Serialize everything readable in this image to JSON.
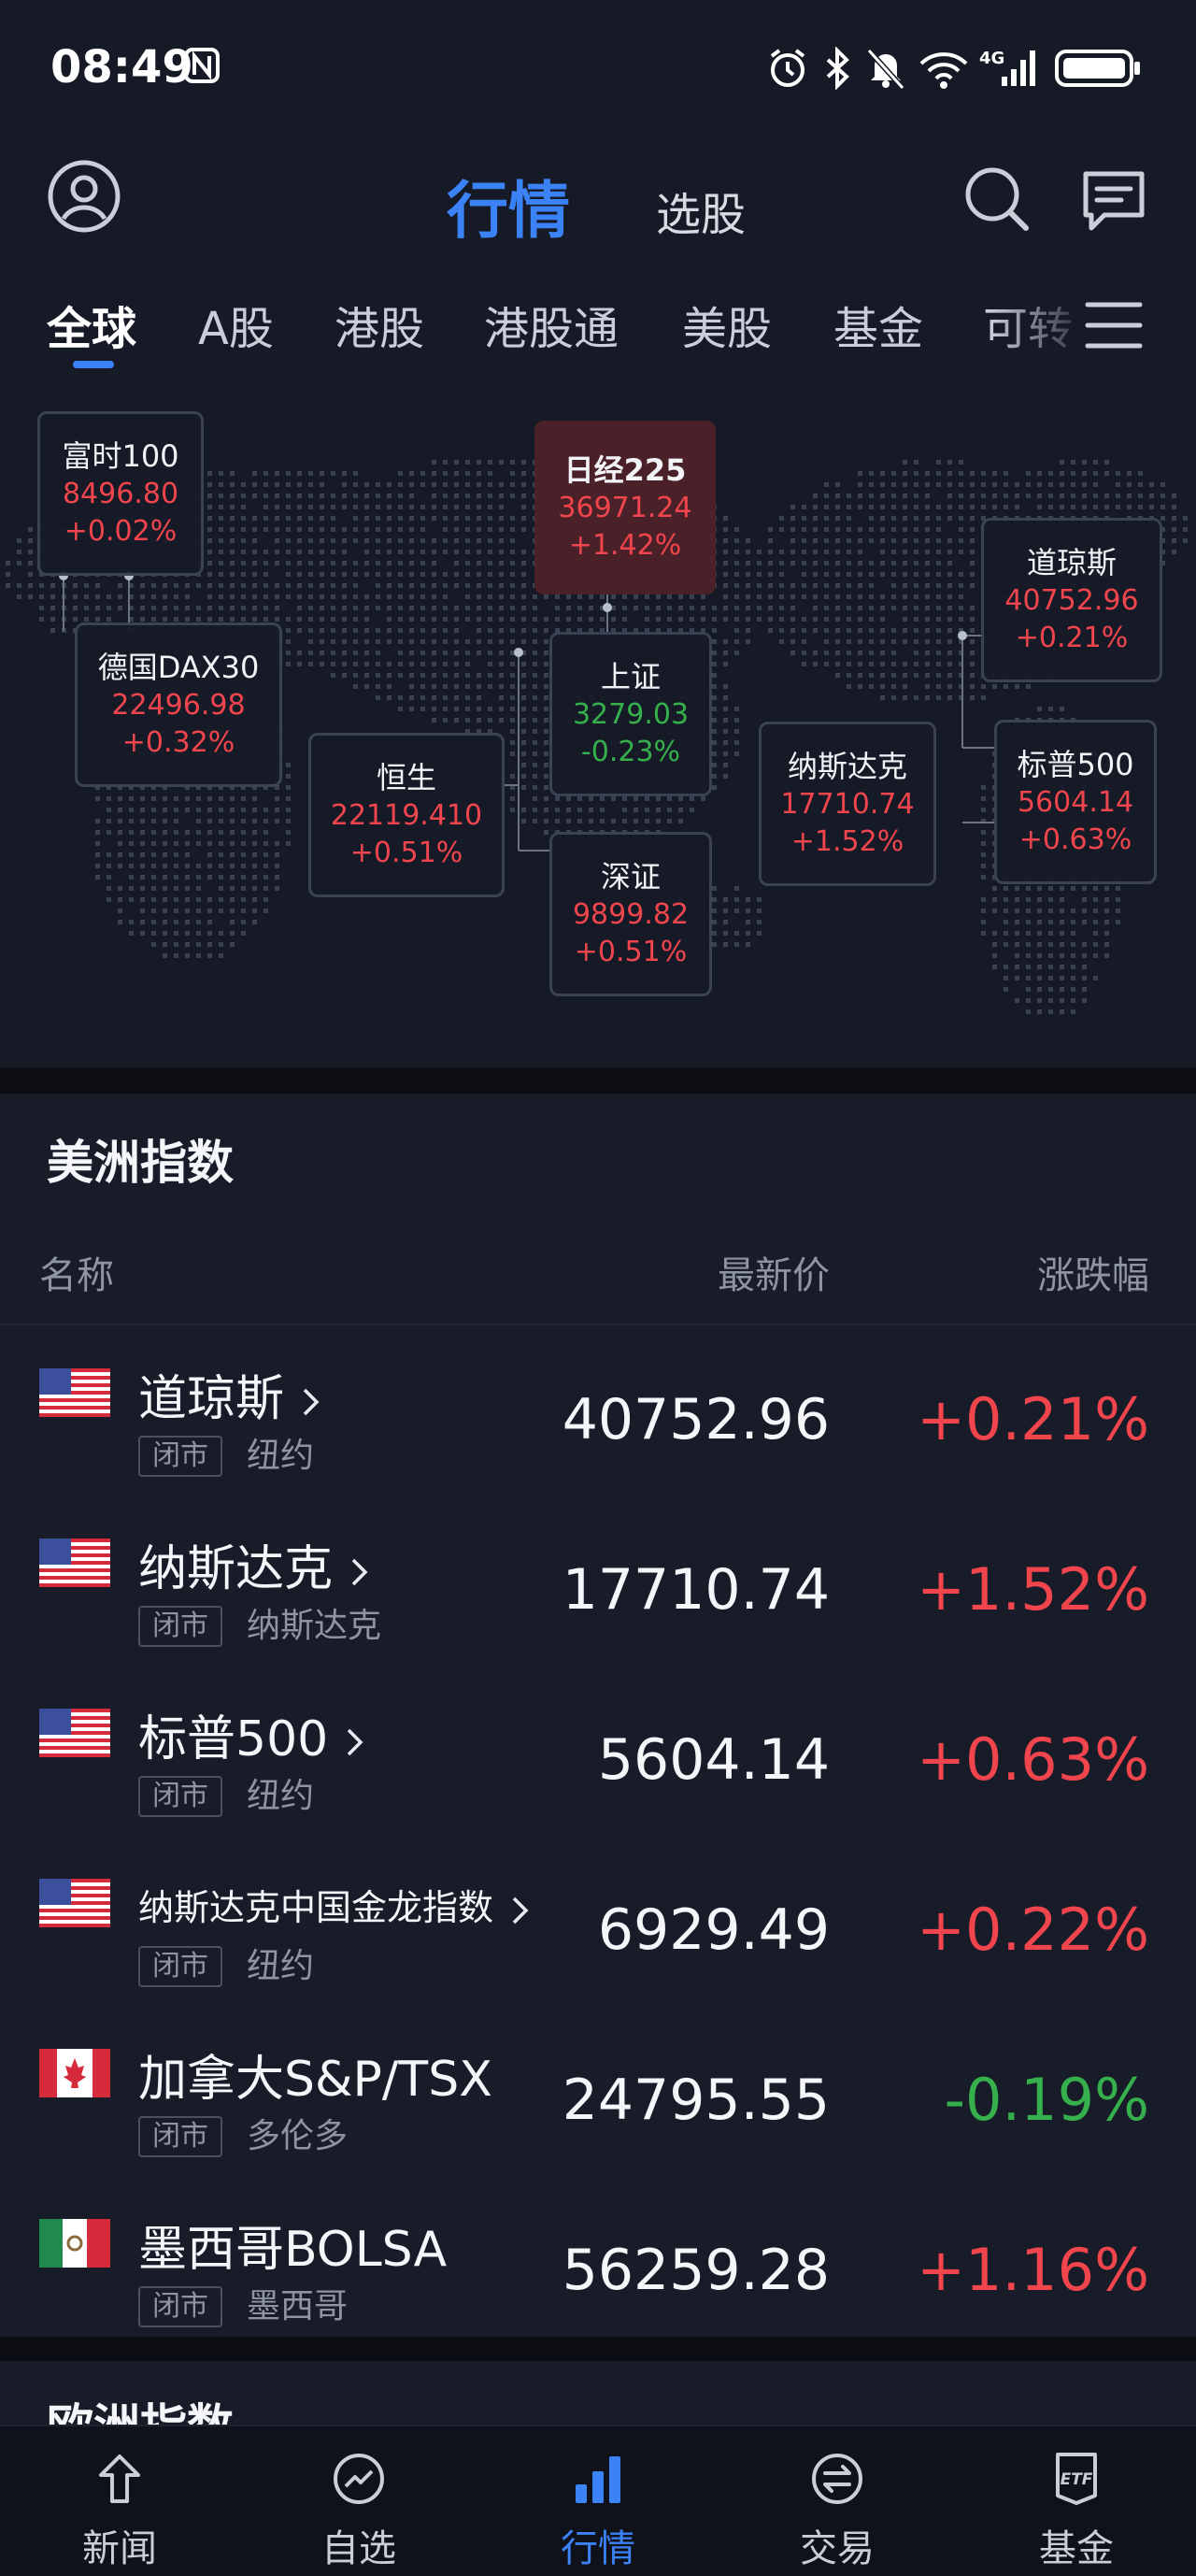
{
  "status_bar": {
    "time": "08:49",
    "network": "4G"
  },
  "header": {
    "title": "行情",
    "subtitle": "选股"
  },
  "tabs": [
    "全球",
    "A股",
    "港股",
    "港股通",
    "美股",
    "基金",
    "可转"
  ],
  "map_cards": [
    {
      "name": "富时100",
      "price": "8496.80",
      "change": "+0.02%",
      "dir": "up"
    },
    {
      "name": "日经225",
      "price": "36971.24",
      "change": "+1.42%",
      "dir": "up"
    },
    {
      "name": "道琼斯",
      "price": "40752.96",
      "change": "+0.21%",
      "dir": "up"
    },
    {
      "name": "德国DAX30",
      "price": "22496.98",
      "change": "+0.32%",
      "dir": "up"
    },
    {
      "name": "上证",
      "price": "3279.03",
      "change": "-0.23%",
      "dir": "down"
    },
    {
      "name": "恒生",
      "price": "22119.410",
      "change": "+0.51%",
      "dir": "up"
    },
    {
      "name": "纳斯达克",
      "price": "17710.74",
      "change": "+1.52%",
      "dir": "up"
    },
    {
      "name": "标普500",
      "price": "5604.14",
      "change": "+0.63%",
      "dir": "up"
    },
    {
      "name": "深证",
      "price": "9899.82",
      "change": "+0.51%",
      "dir": "up"
    }
  ],
  "americas": {
    "title": "美洲指数",
    "col_name": "名称",
    "col_price": "最新价",
    "col_change": "涨跌幅",
    "rows": [
      {
        "flag": "us-flag",
        "name": "道琼斯",
        "status": "闭市",
        "exchange": "纽约",
        "price": "40752.96",
        "change": "+0.21%",
        "dir": "up"
      },
      {
        "flag": "us-flag",
        "name": "纳斯达克",
        "status": "闭市",
        "exchange": "纳斯达克",
        "price": "17710.74",
        "change": "+1.52%",
        "dir": "up"
      },
      {
        "flag": "us-flag",
        "name": "标普500",
        "status": "闭市",
        "exchange": "纽约",
        "price": "5604.14",
        "change": "+0.63%",
        "dir": "up"
      },
      {
        "flag": "us-flag",
        "name": "纳斯达克中国金龙指数",
        "status": "闭市",
        "exchange": "纽约",
        "price": "6929.49",
        "change": "+0.22%",
        "dir": "up"
      },
      {
        "flag": "canada-flag",
        "name": "加拿大S&P/TSX",
        "status": "闭市",
        "exchange": "多伦多",
        "price": "24795.55",
        "change": "-0.19%",
        "dir": "down"
      },
      {
        "flag": "mexico-flag",
        "name": "墨西哥BOLSA",
        "status": "闭市",
        "exchange": "墨西哥",
        "price": "56259.28",
        "change": "+1.16%",
        "dir": "up"
      }
    ]
  },
  "europe": {
    "title": "欧洲指数"
  },
  "bottom_nav": [
    {
      "label": "新闻",
      "icon": "news-icon"
    },
    {
      "label": "自选",
      "icon": "watchlist-icon"
    },
    {
      "label": "行情",
      "icon": "market-icon",
      "active": true
    },
    {
      "label": "交易",
      "icon": "trade-icon"
    },
    {
      "label": "基金",
      "icon": "etf-icon"
    }
  ],
  "colors": {
    "accent": "#3b82f6",
    "up": "#f0454d",
    "down": "#35b04c",
    "background": "#161a26"
  }
}
